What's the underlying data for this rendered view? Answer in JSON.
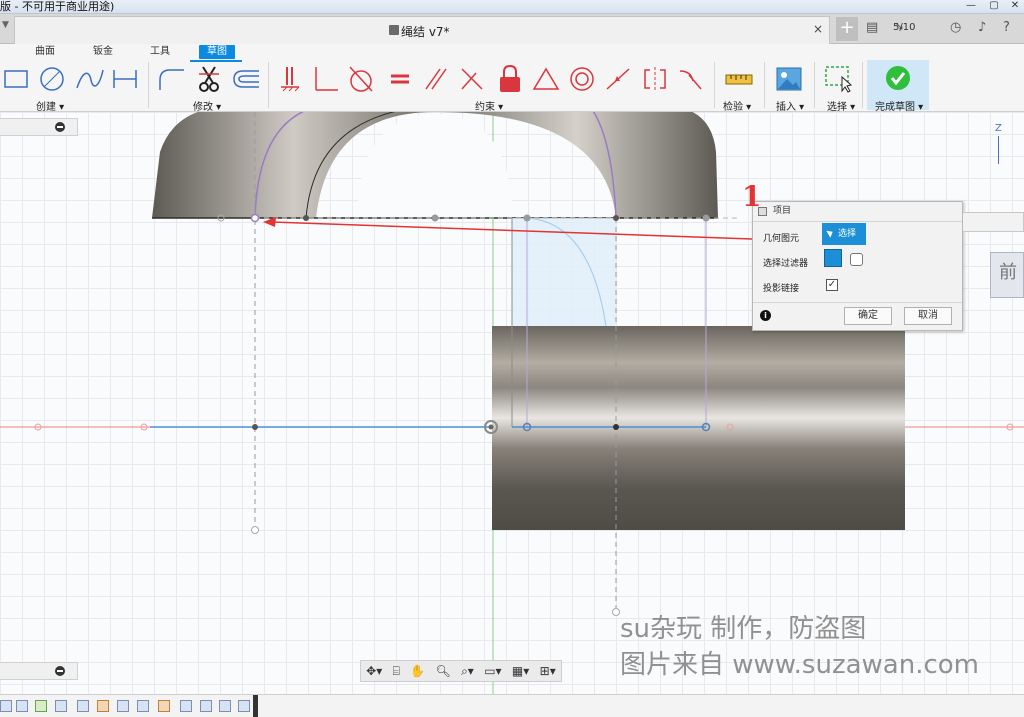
{
  "window": {
    "title": "版 - 不可用于商业用途)",
    "controls": [
      "minimize",
      "maximize",
      "close"
    ]
  },
  "document_tab": {
    "title": "绳结 v7*",
    "close": "×"
  },
  "header": {
    "jobs": "5/10"
  },
  "workspace_tabs": [
    {
      "label": "曲面",
      "active": false
    },
    {
      "label": "钣金",
      "active": false
    },
    {
      "label": "工具",
      "active": false
    },
    {
      "label": "草图",
      "active": true
    }
  ],
  "toolbar_groups": {
    "create": "创建 ▾",
    "modify": "修改 ▾",
    "constraints": "约束 ▾",
    "inspect": "检验 ▾",
    "insert": "插入 ▾",
    "select": "选择 ▾",
    "finish": "完成草图 ▾"
  },
  "tool_icons": {
    "create": [
      "rectangle-icon",
      "circle-icon",
      "spline-icon",
      "dimension-icon"
    ],
    "modify": [
      "fillet-icon",
      "trim-icon",
      "offset-icon"
    ],
    "constraints": [
      "fix-icon",
      "coincident-icon",
      "tangent-icon",
      "equal-icon",
      "parallel-icon",
      "perpendicular-icon",
      "lock-icon",
      "triangle-icon",
      "concentric-icon",
      "midpoint-icon",
      "symmetric-icon",
      "curvature-icon"
    ],
    "inspect": [
      "measure-icon"
    ],
    "insert": [
      "image-icon"
    ],
    "select": [
      "select-icon"
    ],
    "finish": [
      "finish-check-icon"
    ]
  },
  "viewcube": {
    "label": "前",
    "axis": "Z"
  },
  "dialog": {
    "title": "项目",
    "geometry_label": "几何图元",
    "select_button": "选择",
    "filter_label": "选择过滤器",
    "projection_label": "投影链接",
    "projection_checked": true,
    "ok": "确定",
    "cancel": "取消",
    "info": "i"
  },
  "annotation": {
    "number": "1",
    "color": "#e43333"
  },
  "watermark": {
    "line1": "su杂玩 制作，防盗图",
    "line2": "图片来自 www.suzawan.com"
  },
  "colors": {
    "accent": "#0a8be0",
    "finish_green": "#2fbf3b",
    "constraint_red": "#d9363e",
    "sketch_purple": "#9a7bc4",
    "axis_red": "#f08080",
    "axis_green": "#8ccf8c"
  }
}
